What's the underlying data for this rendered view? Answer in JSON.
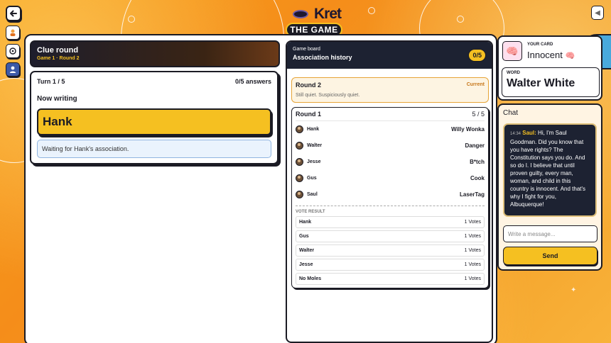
{
  "logo": {
    "word": "Kret",
    "sub": "THE GAME"
  },
  "clue": {
    "title": "Clue round",
    "subtitle": "Game 1 · Round 2"
  },
  "turn": {
    "label": "Turn 1 / 5",
    "answers": "0/5 answers",
    "now_writing": "Now writing",
    "writer": "Hank",
    "waiting": "Waiting for Hank's association."
  },
  "board": {
    "kicker": "Game board",
    "title": "Association history",
    "count": "0/5",
    "current_round": {
      "title": "Round 2",
      "tag": "Current",
      "desc": "Still quiet. Suspiciously quiet."
    },
    "round1": {
      "title": "Round 1",
      "score": "5 / 5",
      "associations": [
        {
          "name": "Hank",
          "word": "Willy Wonka"
        },
        {
          "name": "Walter",
          "word": "Danger"
        },
        {
          "name": "Jesse",
          "word": "B*tch"
        },
        {
          "name": "Gus",
          "word": "Cook"
        },
        {
          "name": "Saul",
          "word": "LaserTag"
        }
      ],
      "vote_label": "VOTE RESULT",
      "votes": [
        {
          "name": "Hank",
          "votes": "1 Votes"
        },
        {
          "name": "Gus",
          "votes": "1 Votes"
        },
        {
          "name": "Walter",
          "votes": "1 Votes"
        },
        {
          "name": "Jesse",
          "votes": "1 Votes"
        },
        {
          "name": "No Moles",
          "votes": "1 Votes"
        }
      ]
    }
  },
  "card": {
    "kicker": "YOUR CARD",
    "role": "Innocent",
    "role_icon": "brain-icon",
    "word_kicker": "WORD",
    "word": "Walter White"
  },
  "chat": {
    "title": "Chat",
    "message": {
      "time": "14:34",
      "author": "Saul:",
      "text": "Hi, I'm Saul Goodman. Did you know that you have rights? The Constitution says you do. And so do I. I believe that until proven guilty, every man, woman, and child in this country is innocent. And that's why I fight for you, Albuquerque!"
    },
    "input_placeholder": "Write a message...",
    "send_label": "Send"
  },
  "colors": {
    "accent": "#f5c021",
    "dark": "#1d2232",
    "background": "#f58d1a",
    "info": "#49a9dc"
  }
}
